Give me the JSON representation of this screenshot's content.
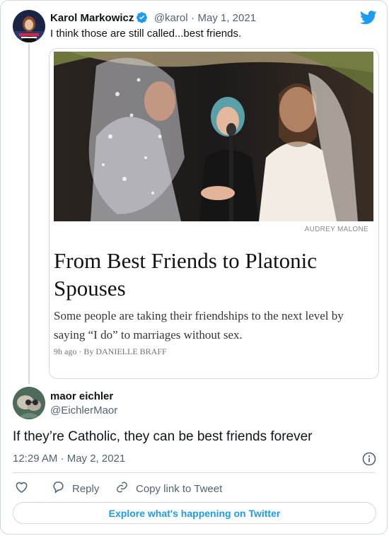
{
  "quoted_tweet": {
    "author_name": "Karol Markowicz",
    "handle": "@karol",
    "separator": "·",
    "date": "May 1, 2021",
    "text": "I think those are still called...best friends.",
    "article": {
      "photo_credit": "AUDREY MALONE",
      "headline": "From Best Friends to Platonic Spouses",
      "summary": "Some people are taking their friendships to the next level by saying “I do” to marriages without sex.",
      "time": "9h ago",
      "byline_sep": "·",
      "byline": "By DANIELLE BRAFF"
    }
  },
  "reply_tweet": {
    "author_name": "maor eichler",
    "handle": "@EichlerMaor",
    "text": "If they’re Catholic, they can be best friends forever",
    "time": "12:29 AM · May 2, 2021"
  },
  "actions": {
    "reply_label": "Reply",
    "copy_link_label": "Copy link to Tweet"
  },
  "explore_label": "Explore what's happening on Twitter",
  "colors": {
    "twitter_blue": "#1d9bf0",
    "muted": "#536471",
    "border": "#cfd9de"
  },
  "icons": [
    "twitter-bird-icon",
    "verified-badge-icon",
    "info-icon",
    "heart-icon",
    "reply-icon",
    "link-icon"
  ]
}
